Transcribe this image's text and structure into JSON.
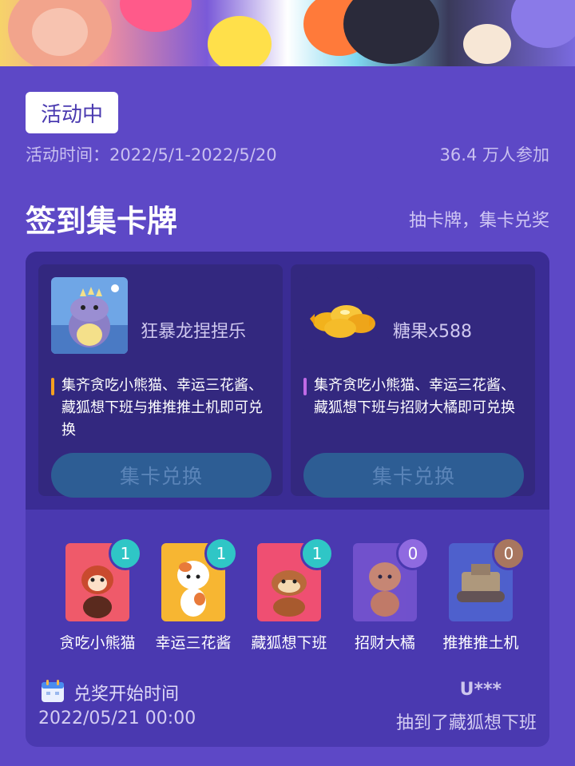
{
  "status": {
    "label": "活动中"
  },
  "event": {
    "time_text": "活动时间：2022/5/1-2022/5/20",
    "participants": "36.4 万人参加"
  },
  "section": {
    "title": "签到集卡牌",
    "subtitle": "抽卡牌，集卡兑奖"
  },
  "rewards": [
    {
      "name": "狂暴龙捏捏乐",
      "desc": "集齐贪吃小熊猫、幸运三花酱、藏狐想下班与推推推土机即可兑换",
      "button": "集卡兑换",
      "icon": "dinosaur-toy-icon"
    },
    {
      "name": "糖果x588",
      "desc": "集齐贪吃小熊猫、幸运三花酱、藏狐想下班与招财大橘即可兑换",
      "button": "集卡兑换",
      "icon": "candy-pile-icon"
    }
  ],
  "cards": [
    {
      "label": "贪吃小熊猫",
      "count": "1",
      "badge_color": "#2fc6c6",
      "bg": "#ef5a6a"
    },
    {
      "label": "幸运三花酱",
      "count": "1",
      "badge_color": "#2fc6c6",
      "bg": "#f7b632"
    },
    {
      "label": "藏狐想下班",
      "count": "1",
      "badge_color": "#2fc6c6",
      "bg": "#ef4f72"
    },
    {
      "label": "招财大橘",
      "count": "0",
      "badge_color": "#8f6ae0",
      "bg": "#7e5ad6"
    },
    {
      "label": "推推推土机",
      "count": "0",
      "badge_color": "#a8765f",
      "bg": "#4f6ad4"
    }
  ],
  "footer": {
    "start_label": "兑奖开始时间",
    "start_time": "2022/05/21 00:00",
    "winner_user": "U***",
    "winner_msg": "抽到了藏狐想下班"
  },
  "icons": {
    "calendar": "calendar-icon"
  }
}
